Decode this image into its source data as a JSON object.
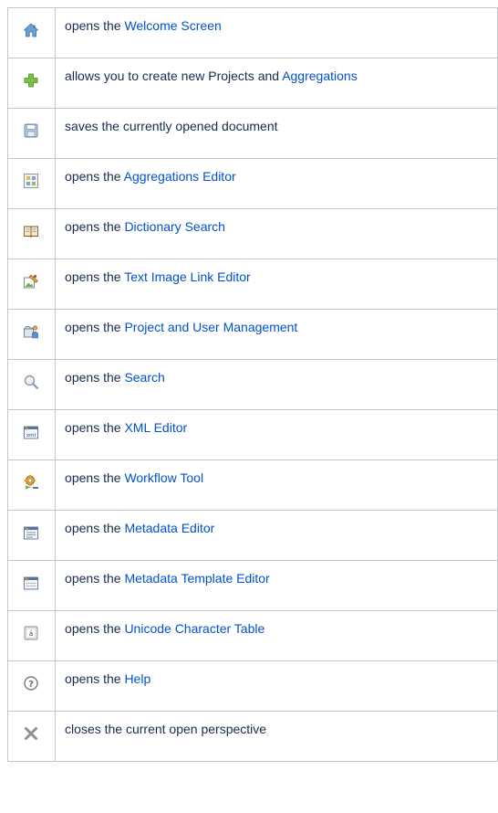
{
  "rows": [
    {
      "icon": "home-icon",
      "prefix": "opens the ",
      "link": "Welcome Screen",
      "suffix": ""
    },
    {
      "icon": "plus-icon",
      "prefix": "allows you to create new Projects and ",
      "link": "Aggregations",
      "suffix": ""
    },
    {
      "icon": "save-icon",
      "prefix": "saves the currently opened document",
      "link": "",
      "suffix": ""
    },
    {
      "icon": "aggregations-editor-icon",
      "prefix": "opens the ",
      "link": "Aggregations Editor",
      "suffix": ""
    },
    {
      "icon": "dictionary-book-icon",
      "prefix": "opens the ",
      "link": "Dictionary Search",
      "suffix": ""
    },
    {
      "icon": "text-image-link-icon",
      "prefix": "opens the ",
      "link": "Text Image Link Editor",
      "suffix": ""
    },
    {
      "icon": "user-management-icon",
      "prefix": "opens the ",
      "link": "Project and User Management",
      "suffix": ""
    },
    {
      "icon": "magnifier-icon",
      "prefix": "opens the ",
      "link": "Search",
      "suffix": ""
    },
    {
      "icon": "xml-editor-icon",
      "prefix": "opens the ",
      "link": "XML Editor",
      "suffix": ""
    },
    {
      "icon": "workflow-gear-icon",
      "prefix": "opens the ",
      "link": "Workflow Tool",
      "suffix": ""
    },
    {
      "icon": "metadata-editor-icon",
      "prefix": "opens the ",
      "link": "Metadata Editor",
      "suffix": ""
    },
    {
      "icon": "metadata-template-icon",
      "prefix": "opens the ",
      "link": "Metadata Template Editor",
      "suffix": ""
    },
    {
      "icon": "unicode-table-icon",
      "prefix": "opens the ",
      "link": "Unicode Character Table",
      "suffix": ""
    },
    {
      "icon": "help-icon",
      "prefix": "opens the ",
      "link": "Help",
      "suffix": ""
    },
    {
      "icon": "close-x-icon",
      "prefix": "closes the current open perspective",
      "link": "",
      "suffix": ""
    }
  ],
  "colors": {
    "link": "#0052cc",
    "text": "#172b4d",
    "border": "#c1c7d0"
  }
}
